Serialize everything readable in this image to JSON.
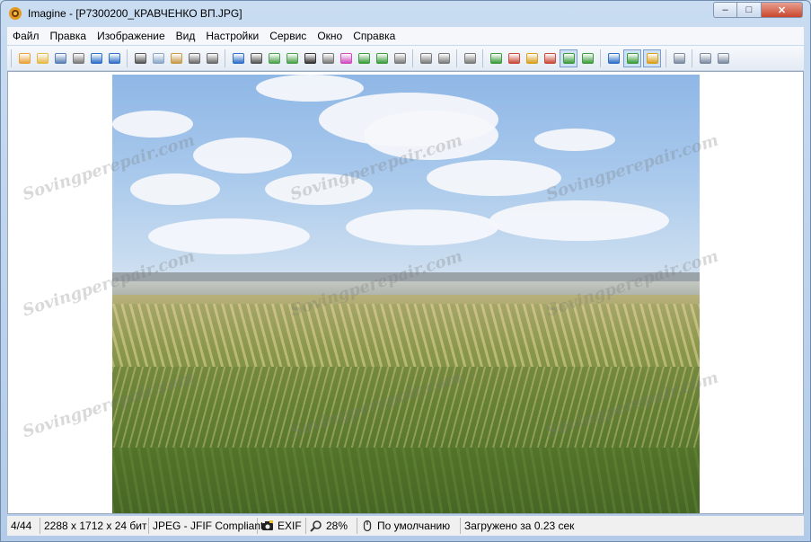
{
  "window": {
    "title": "Imagine - [P7300200_КРАВЧЕНКО ВП.JPG]",
    "controls": {
      "minimize": "–",
      "maximize": "□",
      "close": "✕"
    }
  },
  "menu": [
    {
      "label": "Файл",
      "name": "menu-file"
    },
    {
      "label": "Правка",
      "name": "menu-edit"
    },
    {
      "label": "Изображение",
      "name": "menu-image"
    },
    {
      "label": "Вид",
      "name": "menu-view"
    },
    {
      "label": "Настройки",
      "name": "menu-settings"
    },
    {
      "label": "Сервис",
      "name": "menu-tools"
    },
    {
      "label": "Окно",
      "name": "menu-window"
    },
    {
      "label": "Справка",
      "name": "menu-help"
    }
  ],
  "toolbar": [
    {
      "icon": "new-icon",
      "color": "#e8a33a"
    },
    {
      "icon": "open-folder-icon",
      "color": "#e6b84a"
    },
    {
      "icon": "save-icon",
      "color": "#5a7fb5"
    },
    {
      "icon": "print-icon",
      "color": "#7a7a7a"
    },
    {
      "icon": "previous-icon",
      "color": "#2f6fc7"
    },
    {
      "icon": "next-icon",
      "color": "#2f6fc7"
    },
    {
      "sep": true
    },
    {
      "icon": "cut-icon",
      "color": "#555555"
    },
    {
      "icon": "copy-icon",
      "color": "#8aa6c8"
    },
    {
      "icon": "paste-icon",
      "color": "#c59a4a"
    },
    {
      "icon": "undo-icon",
      "color": "#6b6b6b"
    },
    {
      "icon": "redo-icon",
      "color": "#6b6b6b"
    },
    {
      "sep": true
    },
    {
      "icon": "info-icon",
      "color": "#2f6fc7"
    },
    {
      "icon": "camera-icon",
      "color": "#555555"
    },
    {
      "icon": "export-icon",
      "color": "#4aa04a"
    },
    {
      "icon": "import-icon",
      "color": "#4aa04a"
    },
    {
      "icon": "grayscale-icon",
      "color": "#333333"
    },
    {
      "icon": "adjust-icon",
      "color": "#777777"
    },
    {
      "icon": "color-icon",
      "color": "#d04ac0"
    },
    {
      "icon": "rotate-down-icon",
      "color": "#3c9c3c"
    },
    {
      "icon": "rotate-up-icon",
      "color": "#3c9c3c"
    },
    {
      "icon": "flip-icon",
      "color": "#7a7a7a"
    },
    {
      "sep": true
    },
    {
      "icon": "page-left-icon",
      "color": "#7a7a7a"
    },
    {
      "icon": "page-right-icon",
      "color": "#7a7a7a"
    },
    {
      "sep": true
    },
    {
      "icon": "crop-icon",
      "color": "#7a7a7a"
    },
    {
      "sep": true
    },
    {
      "icon": "zoom-in-icon",
      "color": "#3c9c3c"
    },
    {
      "icon": "zoom-out-icon",
      "color": "#c94a3a"
    },
    {
      "icon": "magic-icon",
      "color": "#d8a020"
    },
    {
      "icon": "slideshow-icon",
      "color": "#c94a3a"
    },
    {
      "icon": "fit-window-icon",
      "color": "#3c9c3c",
      "pressed": true
    },
    {
      "icon": "actual-size-icon",
      "color": "#3c9c3c"
    },
    {
      "sep": true
    },
    {
      "icon": "monitor-icon",
      "color": "#2f6fc7"
    },
    {
      "icon": "thumbnails-icon",
      "color": "#3c9c3c",
      "pressed": true
    },
    {
      "icon": "edit-pencil-icon",
      "color": "#d8a020",
      "pressed": true
    },
    {
      "sep": true
    },
    {
      "icon": "wrench-icon",
      "color": "#7a8aa0"
    },
    {
      "sep": true
    },
    {
      "icon": "plugin-icon",
      "color": "#7a8aa0"
    },
    {
      "icon": "options-icon",
      "color": "#7a8aa0"
    }
  ],
  "watermark": "Sovingperepair.com",
  "status": {
    "position": "4/44",
    "dimensions": "2288 x 1712 x 24 бит",
    "format": "JPEG - JFIF Compliant",
    "exif": "EXIF",
    "zoom": "28%",
    "mode": "По умолчанию",
    "load_time": "Загружено за 0.23 сек"
  }
}
